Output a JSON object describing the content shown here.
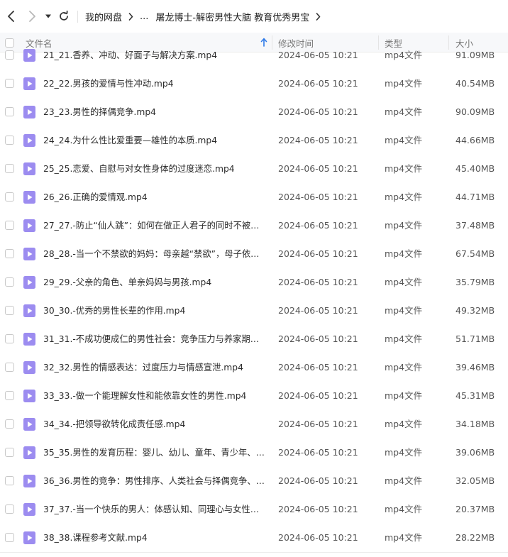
{
  "nav": {
    "back_icon": "chevron-left-icon",
    "forward_icon": "chevron-right-icon",
    "dropdown_icon": "caret-down-icon",
    "refresh_icon": "refresh-icon"
  },
  "breadcrumb": {
    "root": "我的网盘",
    "ellipsis": "...",
    "current": "屠龙博士-解密男性大脑 教育优秀男宝"
  },
  "table": {
    "headers": {
      "name": "文件名",
      "modified": "修改时间",
      "type": "类型",
      "size": "大小"
    },
    "sort_icon": "arrow-up-icon",
    "rows": [
      {
        "name": "21_21.香养、冲动、好面子与解决方案.mp4",
        "modified": "2024-06-05 10:21",
        "type": "mp4文件",
        "size": "91.09MB"
      },
      {
        "name": "22_22.男孩的爱情与性冲动.mp4",
        "modified": "2024-06-05 10:21",
        "type": "mp4文件",
        "size": "40.54MB"
      },
      {
        "name": "23_23.男性的择偶竞争.mp4",
        "modified": "2024-06-05 10:21",
        "type": "mp4文件",
        "size": "90.09MB"
      },
      {
        "name": "24_24.为什么性比爱重要—雄性的本质.mp4",
        "modified": "2024-06-05 10:21",
        "type": "mp4文件",
        "size": "44.66MB"
      },
      {
        "name": "25_25.恋爱、自慰与对女性身体的过度迷恋.mp4",
        "modified": "2024-06-05 10:21",
        "type": "mp4文件",
        "size": "45.40MB"
      },
      {
        "name": "26_26.正确的爱情观.mp4",
        "modified": "2024-06-05 10:21",
        "type": "mp4文件",
        "size": "44.71MB"
      },
      {
        "name": "27_27.-防止“仙人跳”：如何在做正人君子的同时不被…",
        "modified": "2024-06-05 10:21",
        "type": "mp4文件",
        "size": "37.48MB"
      },
      {
        "name": "28_28.-当一个不禁欲的妈妈：母亲越“禁欲”，母子依…",
        "modified": "2024-06-05 10:21",
        "type": "mp4文件",
        "size": "67.54MB"
      },
      {
        "name": "29_29.-父亲的角色、单亲妈妈与男孩.mp4",
        "modified": "2024-06-05 10:21",
        "type": "mp4文件",
        "size": "35.79MB"
      },
      {
        "name": "30_30.-优秀的男性长辈的作用.mp4",
        "modified": "2024-06-05 10:21",
        "type": "mp4文件",
        "size": "49.32MB"
      },
      {
        "name": "31_31.-不成功便成仁的男性社会：竞争压力与养家期望…",
        "modified": "2024-06-05 10:21",
        "type": "mp4文件",
        "size": "51.71MB"
      },
      {
        "name": "32_32.男性的情感表达：过度压力与情感宣泄.mp4",
        "modified": "2024-06-05 10:21",
        "type": "mp4文件",
        "size": "39.46MB"
      },
      {
        "name": "33_33.-做一个能理解女性和能依靠女性的男性.mp4",
        "modified": "2024-06-05 10:21",
        "type": "mp4文件",
        "size": "45.31MB"
      },
      {
        "name": "34_34.-把领导欲转化成责任感.mp4",
        "modified": "2024-06-05 10:21",
        "type": "mp4文件",
        "size": "34.18MB"
      },
      {
        "name": "35_35.男性的发育历程：婴儿、幼儿、童年、青少年、成…",
        "modified": "2024-06-05 10:21",
        "type": "mp4文件",
        "size": "39.06MB"
      },
      {
        "name": "36_36.男性的竞争：男性排序、人类社会与择偶竞争、认…",
        "modified": "2024-06-05 10:21",
        "type": "mp4文件",
        "size": "32.05MB"
      },
      {
        "name": "37_37.-当一个快乐的男人：体感认知、同理心与女性视…",
        "modified": "2024-06-05 10:21",
        "type": "mp4文件",
        "size": "20.37MB"
      },
      {
        "name": "38_38.课程参考文献.mp4",
        "modified": "2024-06-05 10:21",
        "type": "mp4文件",
        "size": "28.22MB"
      }
    ]
  },
  "colors": {
    "file_icon": "#9c8cf0",
    "header_bg": "#f7f8fa",
    "sort_accent": "#2f7be8"
  }
}
